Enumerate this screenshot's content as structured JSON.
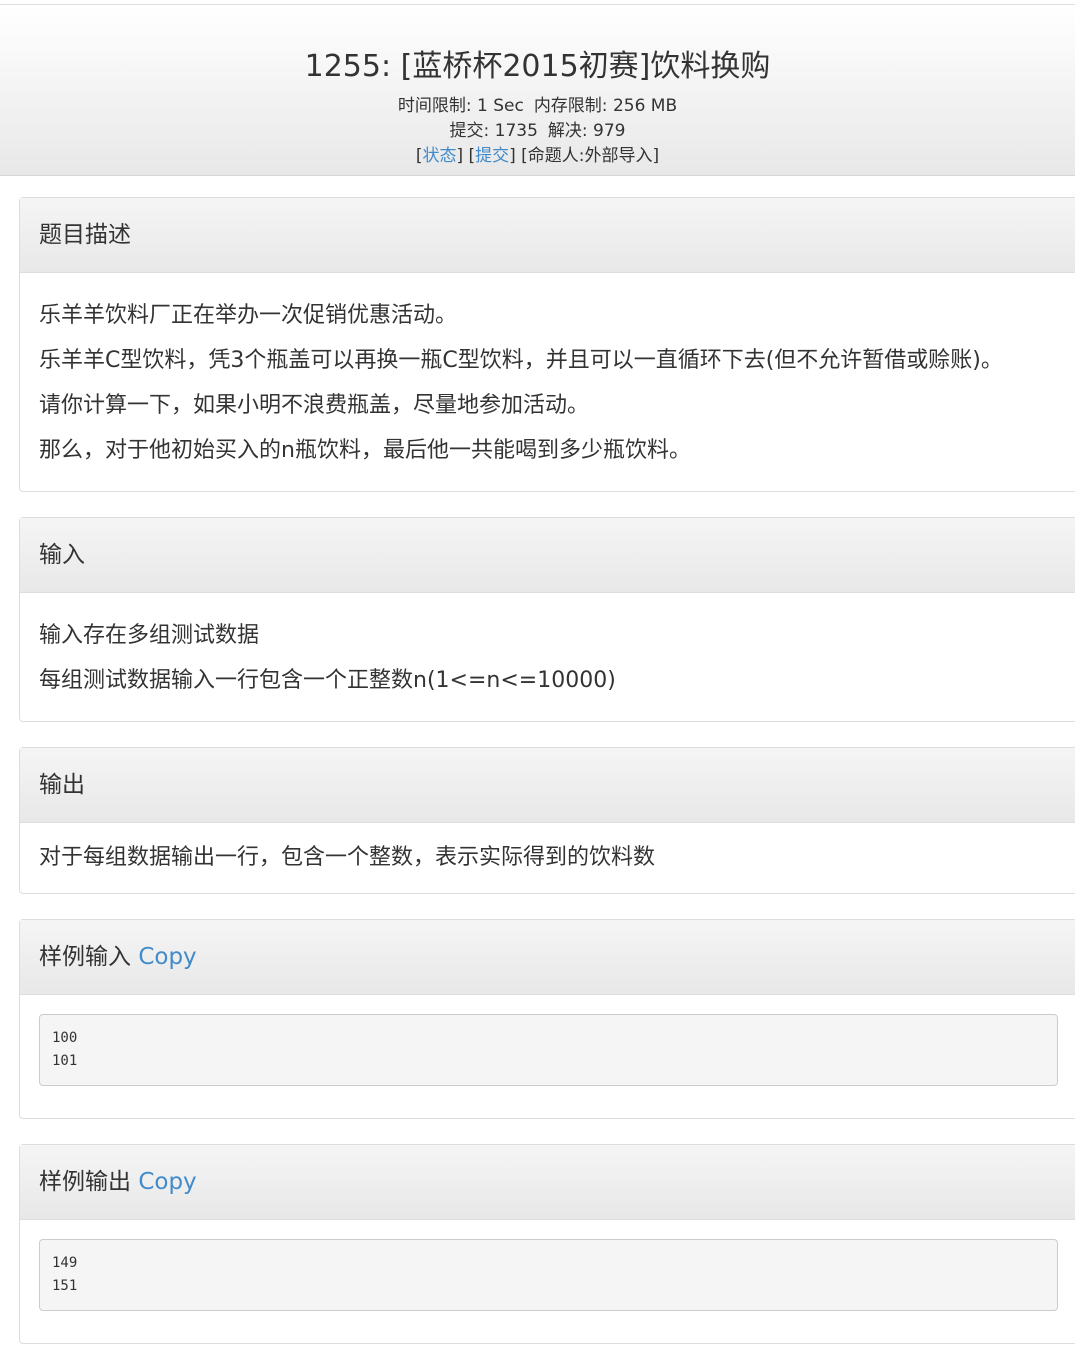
{
  "header": {
    "title": "1255: [蓝桥杯2015初赛]饮料换购",
    "time_limit": "时间限制: 1 Sec",
    "memory_limit": "内存限制: 256 MB",
    "submits": "提交: 1735",
    "solved": "解决: 979",
    "status_link": "状态",
    "submit_link": "提交",
    "author": "[命题人:外部导入]"
  },
  "description": {
    "heading": "题目描述",
    "lines": [
      "乐羊羊饮料厂正在举办一次促销优惠活动。",
      "乐羊羊C型饮料，凭3个瓶盖可以再换一瓶C型饮料，并且可以一直循环下去(但不允许暂借或赊账)。",
      "请你计算一下，如果小明不浪费瓶盖，尽量地参加活动。",
      "那么，对于他初始买入的n瓶饮料，最后他一共能喝到多少瓶饮料。"
    ]
  },
  "input": {
    "heading": "输入",
    "lines": [
      "输入存在多组测试数据",
      "每组测试数据输入一行包含一个正整数n(1<=n<=10000)"
    ]
  },
  "output": {
    "heading": "输出",
    "lines": [
      "对于每组数据输出一行，包含一个整数，表示实际得到的饮料数"
    ]
  },
  "sample_input": {
    "heading": "样例输入",
    "copy_label": "Copy",
    "lines": [
      "100",
      "101"
    ]
  },
  "sample_output": {
    "heading": "样例输出",
    "copy_label": "Copy",
    "lines": [
      "149",
      "151"
    ]
  }
}
